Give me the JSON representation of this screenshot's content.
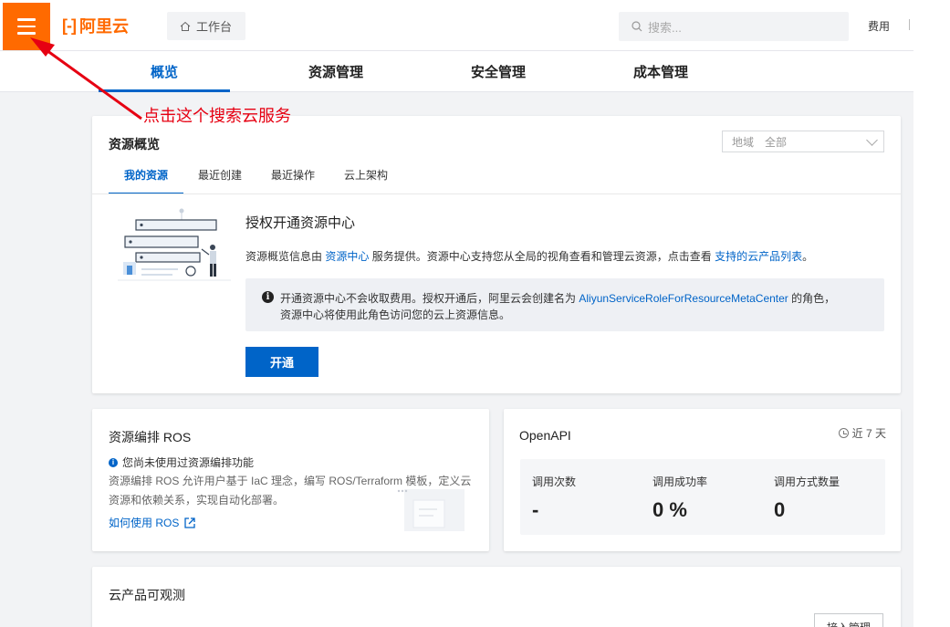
{
  "header": {
    "logo_mark": "[-]",
    "logo_text": "阿里云",
    "workbench_label": "工作台",
    "search_placeholder": "搜索...",
    "fee_label": "费用"
  },
  "tabs": [
    {
      "label": "概览",
      "active": true
    },
    {
      "label": "资源管理",
      "active": false
    },
    {
      "label": "安全管理",
      "active": false
    },
    {
      "label": "成本管理",
      "active": false
    }
  ],
  "annotation": {
    "text": "点击这个搜索云服务",
    "color": "#e60012"
  },
  "resource_overview": {
    "title": "资源概览",
    "region_label": "地域",
    "region_value": "全部",
    "subtabs": [
      "我的资源",
      "最近创建",
      "最近操作",
      "云上架构"
    ],
    "auth_title": "授权开通资源中心",
    "desc_prefix": "资源概览信息由",
    "desc_link1": "资源中心",
    "desc_middle": "服务提供。资源中心支持您从全局的视角查看和管理云资源，点击查看",
    "desc_link2": "支持的云产品列表",
    "desc_suffix": "。",
    "notice_prefix": "开通资源中心不会收取费用。授权开通后，阿里云会创建名为",
    "notice_role": "AliyunServiceRoleForResourceMetaCenter",
    "notice_suffix": "的角色，",
    "notice_line2": "资源中心将使用此角色访问您的云上资源信息。",
    "open_button": "开通"
  },
  "ros": {
    "title": "资源编排 ROS",
    "hint": "您尚未使用过资源编排功能",
    "desc": "资源编排 ROS 允许用户基于 IaC 理念，编写 ROS/Terraform 模板，定义云资源和依赖关系，实现自动化部署。",
    "link": "如何使用 ROS"
  },
  "openapi": {
    "title": "OpenAPI",
    "period": "近 7 天",
    "stats": [
      {
        "label": "调用次数",
        "value": "-"
      },
      {
        "label": "调用成功率",
        "value": "0 %"
      },
      {
        "label": "调用方式数量",
        "value": "0"
      }
    ]
  },
  "observability": {
    "title": "云产品可观测",
    "button": "接入管理"
  },
  "colors": {
    "brand": "#ff6a00",
    "primary": "#0064c8"
  }
}
